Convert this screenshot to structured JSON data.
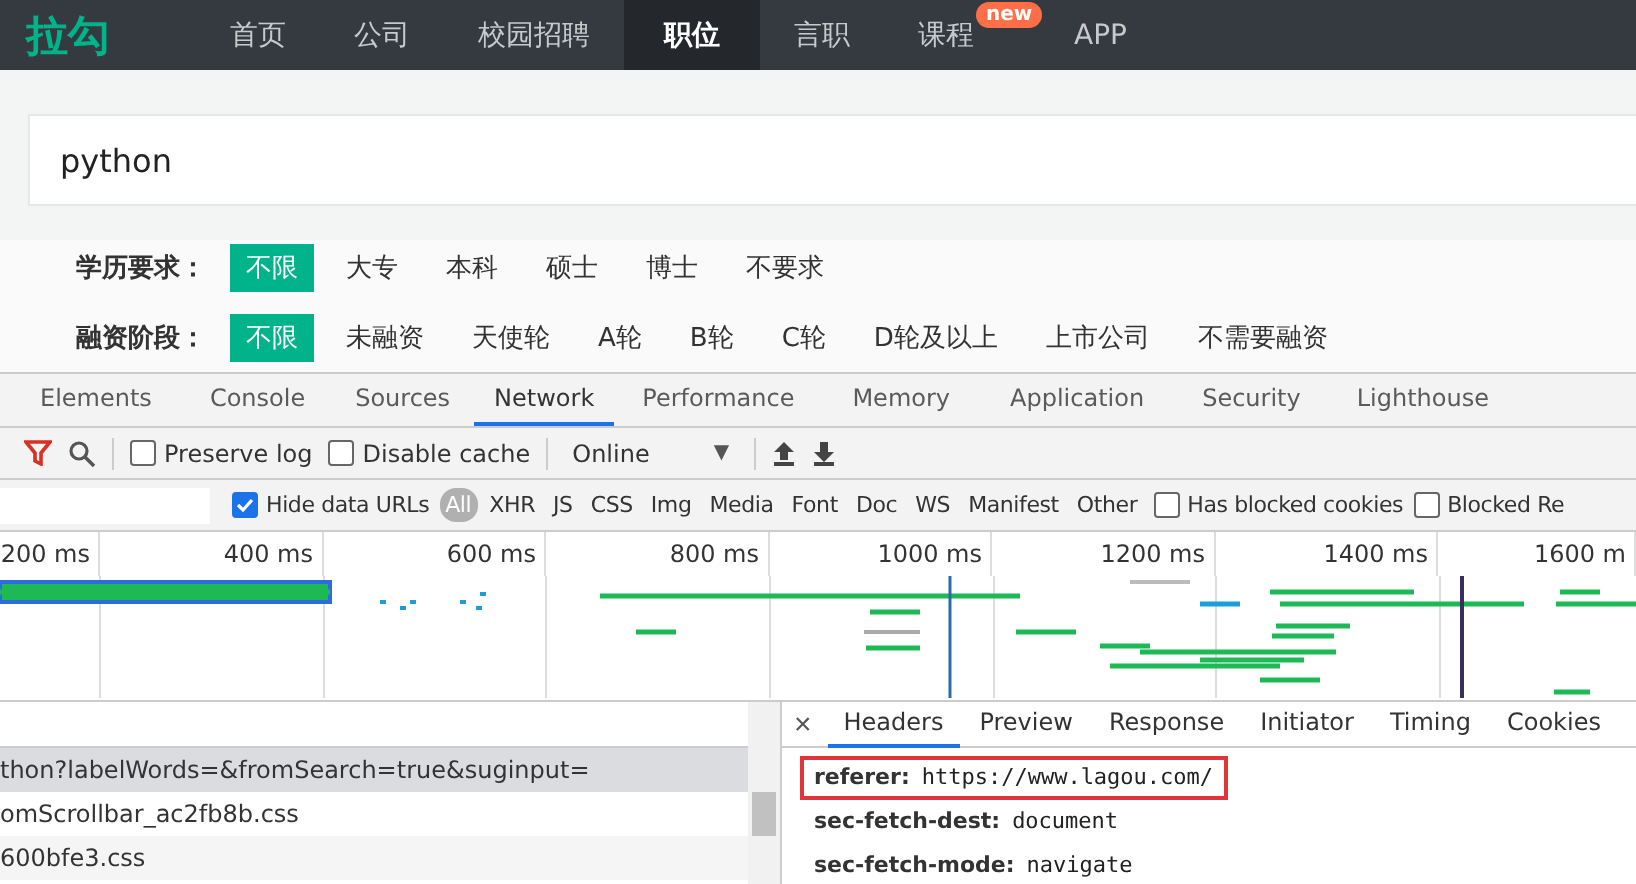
{
  "site_nav": {
    "logo": "拉勾",
    "items": [
      {
        "label": "首页",
        "selected": false
      },
      {
        "label": "公司",
        "selected": false
      },
      {
        "label": "校园招聘",
        "selected": false
      },
      {
        "label": "职位",
        "selected": true
      },
      {
        "label": "言职",
        "selected": false
      },
      {
        "label": "课程",
        "selected": false,
        "badge": "new"
      },
      {
        "label": "APP",
        "selected": false
      }
    ]
  },
  "search": {
    "value": "python"
  },
  "filters": [
    {
      "label": "学历要求：",
      "options": [
        {
          "label": "不限",
          "selected": true
        },
        {
          "label": "大专",
          "selected": false
        },
        {
          "label": "本科",
          "selected": false
        },
        {
          "label": "硕士",
          "selected": false
        },
        {
          "label": "博士",
          "selected": false
        },
        {
          "label": "不要求",
          "selected": false
        }
      ]
    },
    {
      "label": "融资阶段：",
      "options": [
        {
          "label": "不限",
          "selected": true
        },
        {
          "label": "未融资",
          "selected": false
        },
        {
          "label": "天使轮",
          "selected": false
        },
        {
          "label": "A轮",
          "selected": false
        },
        {
          "label": "B轮",
          "selected": false
        },
        {
          "label": "C轮",
          "selected": false
        },
        {
          "label": "D轮及以上",
          "selected": false
        },
        {
          "label": "上市公司",
          "selected": false
        },
        {
          "label": "不需要融资",
          "selected": false
        }
      ]
    }
  ],
  "devtools": {
    "tabs": [
      {
        "label": "Elements",
        "selected": false
      },
      {
        "label": "Console",
        "selected": false
      },
      {
        "label": "Sources",
        "selected": false
      },
      {
        "label": "Network",
        "selected": true
      },
      {
        "label": "Performance",
        "selected": false
      },
      {
        "label": "Memory",
        "selected": false
      },
      {
        "label": "Application",
        "selected": false
      },
      {
        "label": "Security",
        "selected": false
      },
      {
        "label": "Lighthouse",
        "selected": false
      }
    ],
    "toolbar": {
      "checkboxes": [
        {
          "label": "Preserve log",
          "checked": false
        },
        {
          "label": "Disable cache",
          "checked": false
        }
      ],
      "throttling": "Online",
      "throttling_caret": "▼"
    },
    "filter_bar": {
      "hide_data_urls": {
        "label": "Hide data URLs",
        "checked": true
      },
      "types": [
        {
          "label": "All",
          "selected": true
        },
        {
          "label": "XHR",
          "selected": false
        },
        {
          "label": "JS",
          "selected": false
        },
        {
          "label": "CSS",
          "selected": false
        },
        {
          "label": "Img",
          "selected": false
        },
        {
          "label": "Media",
          "selected": false
        },
        {
          "label": "Font",
          "selected": false
        },
        {
          "label": "Doc",
          "selected": false
        },
        {
          "label": "WS",
          "selected": false
        },
        {
          "label": "Manifest",
          "selected": false
        },
        {
          "label": "Other",
          "selected": false
        }
      ],
      "checkboxes": [
        {
          "label": "Has blocked cookies",
          "checked": false
        },
        {
          "label": "Blocked Re",
          "checked": false
        }
      ]
    },
    "timeline_ticks": [
      "200 ms",
      "400 ms",
      "600 ms",
      "800 ms",
      "1000 ms",
      "1200 ms",
      "1400 ms",
      "1600 m"
    ],
    "requests": [
      {
        "name": "thon?labelWords=&fromSearch=true&suginput=",
        "selected": true
      },
      {
        "name": "omScrollbar_ac2fb8b.css",
        "selected": false
      },
      {
        "name": "600bfe3.css",
        "selected": false
      }
    ],
    "detail": {
      "close": "×",
      "tabs": [
        {
          "label": "Headers",
          "selected": true
        },
        {
          "label": "Preview",
          "selected": false
        },
        {
          "label": "Response",
          "selected": false
        },
        {
          "label": "Initiator",
          "selected": false
        },
        {
          "label": "Timing",
          "selected": false
        },
        {
          "label": "Cookies",
          "selected": false
        }
      ],
      "headers": [
        {
          "name": "referer:",
          "value": "https://www.lagou.com/",
          "highlighted": true
        },
        {
          "name": "sec-fetch-dest:",
          "value": "document",
          "highlighted": false
        },
        {
          "name": "sec-fetch-mode:",
          "value": "navigate",
          "highlighted": false
        }
      ]
    }
  }
}
